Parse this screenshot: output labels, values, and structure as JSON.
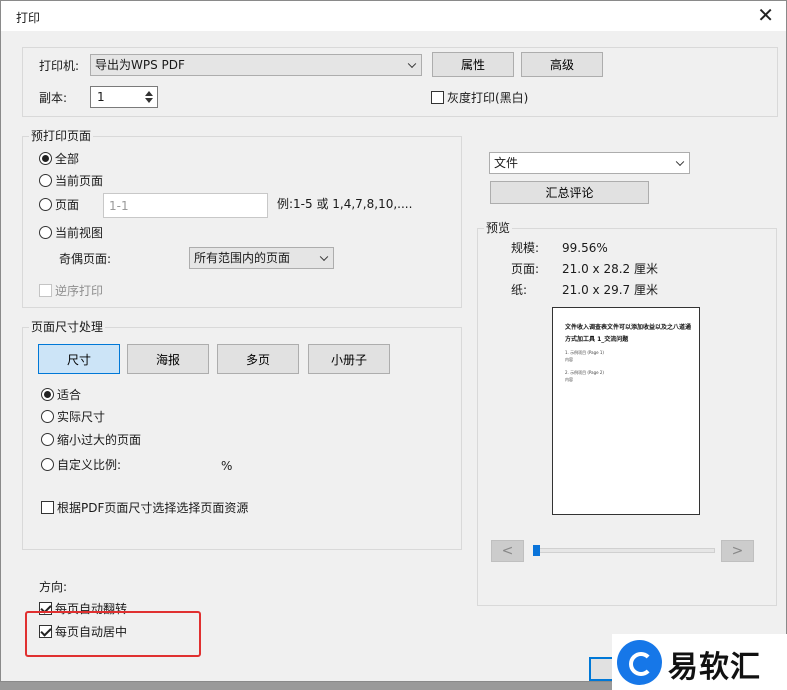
{
  "window": {
    "title": "打印"
  },
  "printer": {
    "label": "打印机:",
    "selected": "导出为WPS PDF",
    "properties_button": "属性",
    "advanced_button": "高级",
    "copies_label": "副本:",
    "copies_value": "1",
    "grayscale_label": "灰度打印(黑白)"
  },
  "page_range": {
    "group_label": "预打印页面",
    "all": "全部",
    "current_page": "当前页面",
    "pages": "页面",
    "pages_placeholder": "1-1",
    "pages_hint": "例:1-5 或 1,4,7,8,10,....",
    "current_view": "当前视图",
    "odd_even_label": "奇偶页面:",
    "odd_even_selected": "所有范围内的页面",
    "reverse_label": "逆序打印"
  },
  "page_sizing": {
    "group_label": "页面尺寸处理",
    "tabs": [
      "尺寸",
      "海报",
      "多页",
      "小册子"
    ],
    "fit": "适合",
    "actual_size": "实际尺寸",
    "shrink": "缩小过大的页面",
    "custom_scale": "自定义比例:",
    "percent": "%",
    "source_label": "根据PDF页面尺寸选择选择页面资源"
  },
  "orientation": {
    "label": "方向:",
    "auto_rotate": "每页自动翻转",
    "auto_center": "每页自动居中"
  },
  "right": {
    "content_selected": "文件",
    "summarize_button": "汇总评论",
    "preview_label": "预览",
    "scale_label": "规模:",
    "scale_value": "99.56%",
    "page_label": "页面:",
    "page_value": "21.0 x 28.2 厘米",
    "paper_label": "纸:",
    "paper_value": "21.0 x 29.7 厘米",
    "prev_glyph": "<",
    "next_glyph": ">",
    "slider_position": 0.0
  },
  "preview_doc": {
    "title": "文件收入调查表文件可以添加收益以及之八道通方式加工具 1_交流问题",
    "line1": "1. 示例项目 (Page 1)",
    "line2": "内容",
    "line3": "2. 示例项目 (Page 2)",
    "line4": "内容"
  },
  "watermark": {
    "text": "易软汇"
  },
  "colors": {
    "accent": "#0078d7",
    "highlight": "#e03030",
    "logo": "#1677e8"
  }
}
